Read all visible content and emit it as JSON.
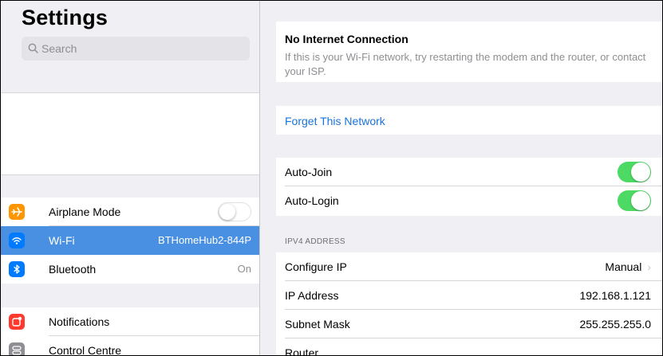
{
  "sidebar": {
    "title": "Settings",
    "search_placeholder": "Search",
    "items": [
      {
        "label": "Airplane Mode",
        "icon": "airplane-icon",
        "color": "#ff9500",
        "value": "",
        "toggle": false
      },
      {
        "label": "Wi-Fi",
        "icon": "wifi-icon",
        "color": "#007aff",
        "value": "BTHomeHub2-844P",
        "selected": true
      },
      {
        "label": "Bluetooth",
        "icon": "bluetooth-icon",
        "color": "#007aff",
        "value": "On"
      },
      {
        "label": "Notifications",
        "icon": "notifications-icon",
        "color": "#ff3b30",
        "value": ""
      },
      {
        "label": "Control Centre",
        "icon": "control-centre-icon",
        "color": "#8e8e93",
        "value": ""
      }
    ]
  },
  "detail": {
    "no_internet_title": "No Internet Connection",
    "no_internet_text": "If this is your Wi-Fi network, try restarting the modem and the router, or contact your ISP.",
    "forget_label": "Forget This Network",
    "auto_join_label": "Auto-Join",
    "auto_join_on": true,
    "auto_login_label": "Auto-Login",
    "auto_login_on": true,
    "ipv4_header": "IPV4 ADDRESS",
    "rows": [
      {
        "label": "Configure IP",
        "value": "Manual"
      },
      {
        "label": "IP Address",
        "value": "192.168.1.121"
      },
      {
        "label": "Subnet Mask",
        "value": "255.255.255.0"
      },
      {
        "label": "Router",
        "value": ""
      }
    ]
  },
  "colors": {
    "accent": "#4a90e2",
    "link": "#1a73d9",
    "toggle_on": "#4cd964"
  }
}
